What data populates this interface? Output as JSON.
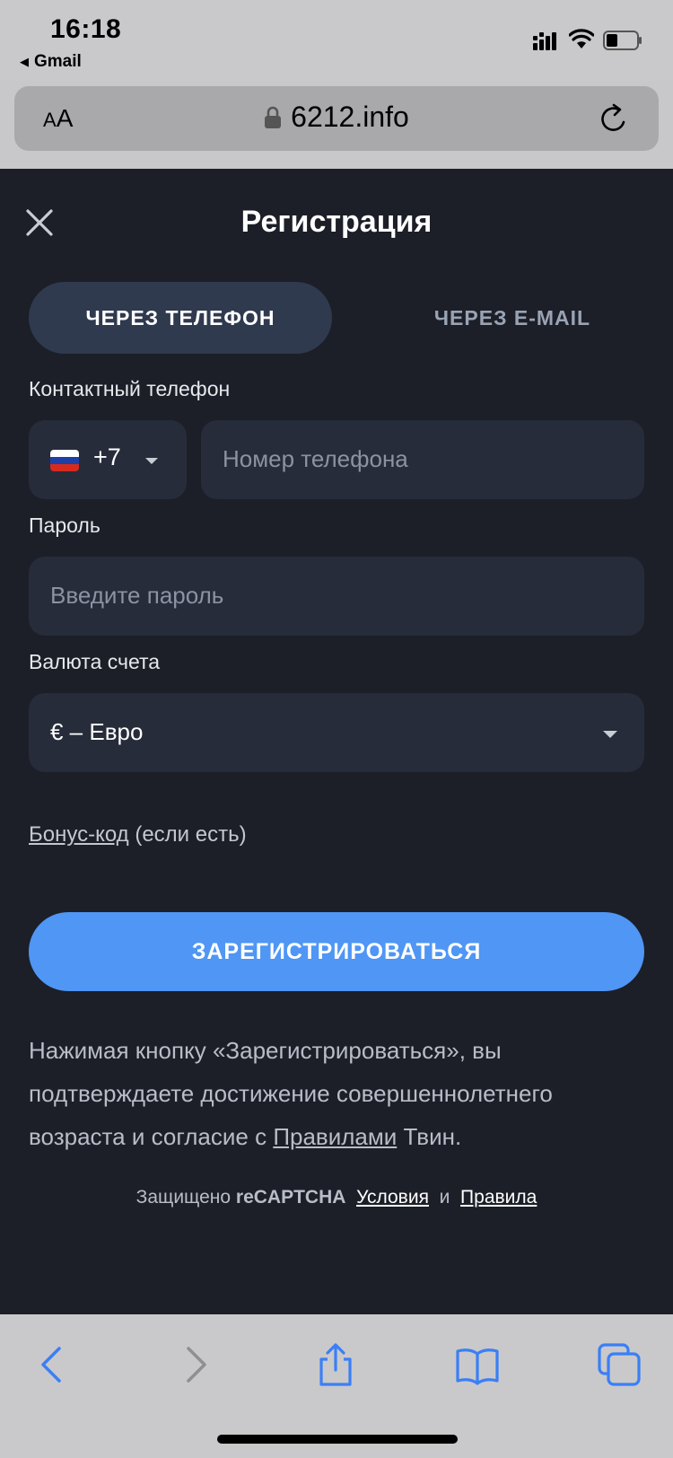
{
  "status_bar": {
    "time": "16:18",
    "back_app": "Gmail"
  },
  "browser": {
    "aa_small": "A",
    "aa_large": "A",
    "url": "6212.info"
  },
  "registration": {
    "title": "Регистрация",
    "tabs": [
      {
        "label": "ЧЕРЕЗ ТЕЛЕФОН",
        "active": true
      },
      {
        "label": "ЧЕРЕЗ E-MAIL",
        "active": false
      }
    ],
    "phone_label": "Контактный телефон",
    "country_code": "+7",
    "phone_placeholder": "Номер телефона",
    "password_label": "Пароль",
    "password_placeholder": "Введите пароль",
    "currency_label": "Валюта счета",
    "currency_value": "€ – Евро",
    "bonus_link": "Бонус-код",
    "bonus_suffix": " (если есть)",
    "submit_label": "ЗАРЕГИСТРИРОВАТЬСЯ",
    "legal_text_1": "Нажимая кнопку «Зарегистрироваться», вы подтверждаете достижение совершеннолетнего возраста и согласие с ",
    "legal_link": "Правилами",
    "legal_text_2": " Твин.",
    "captcha_prefix": "Защищено ",
    "captcha_brand": "reCAPTCHA",
    "captcha_terms": "Условия",
    "captcha_and": " и ",
    "captcha_rules": "Правила"
  },
  "colors": {
    "app_bg": "#1c1f28",
    "field_bg": "#262c3a",
    "active_tab_bg": "#2f3a4f",
    "accent": "#4f96f5",
    "toolbar_icon": "#3a7ff6"
  }
}
